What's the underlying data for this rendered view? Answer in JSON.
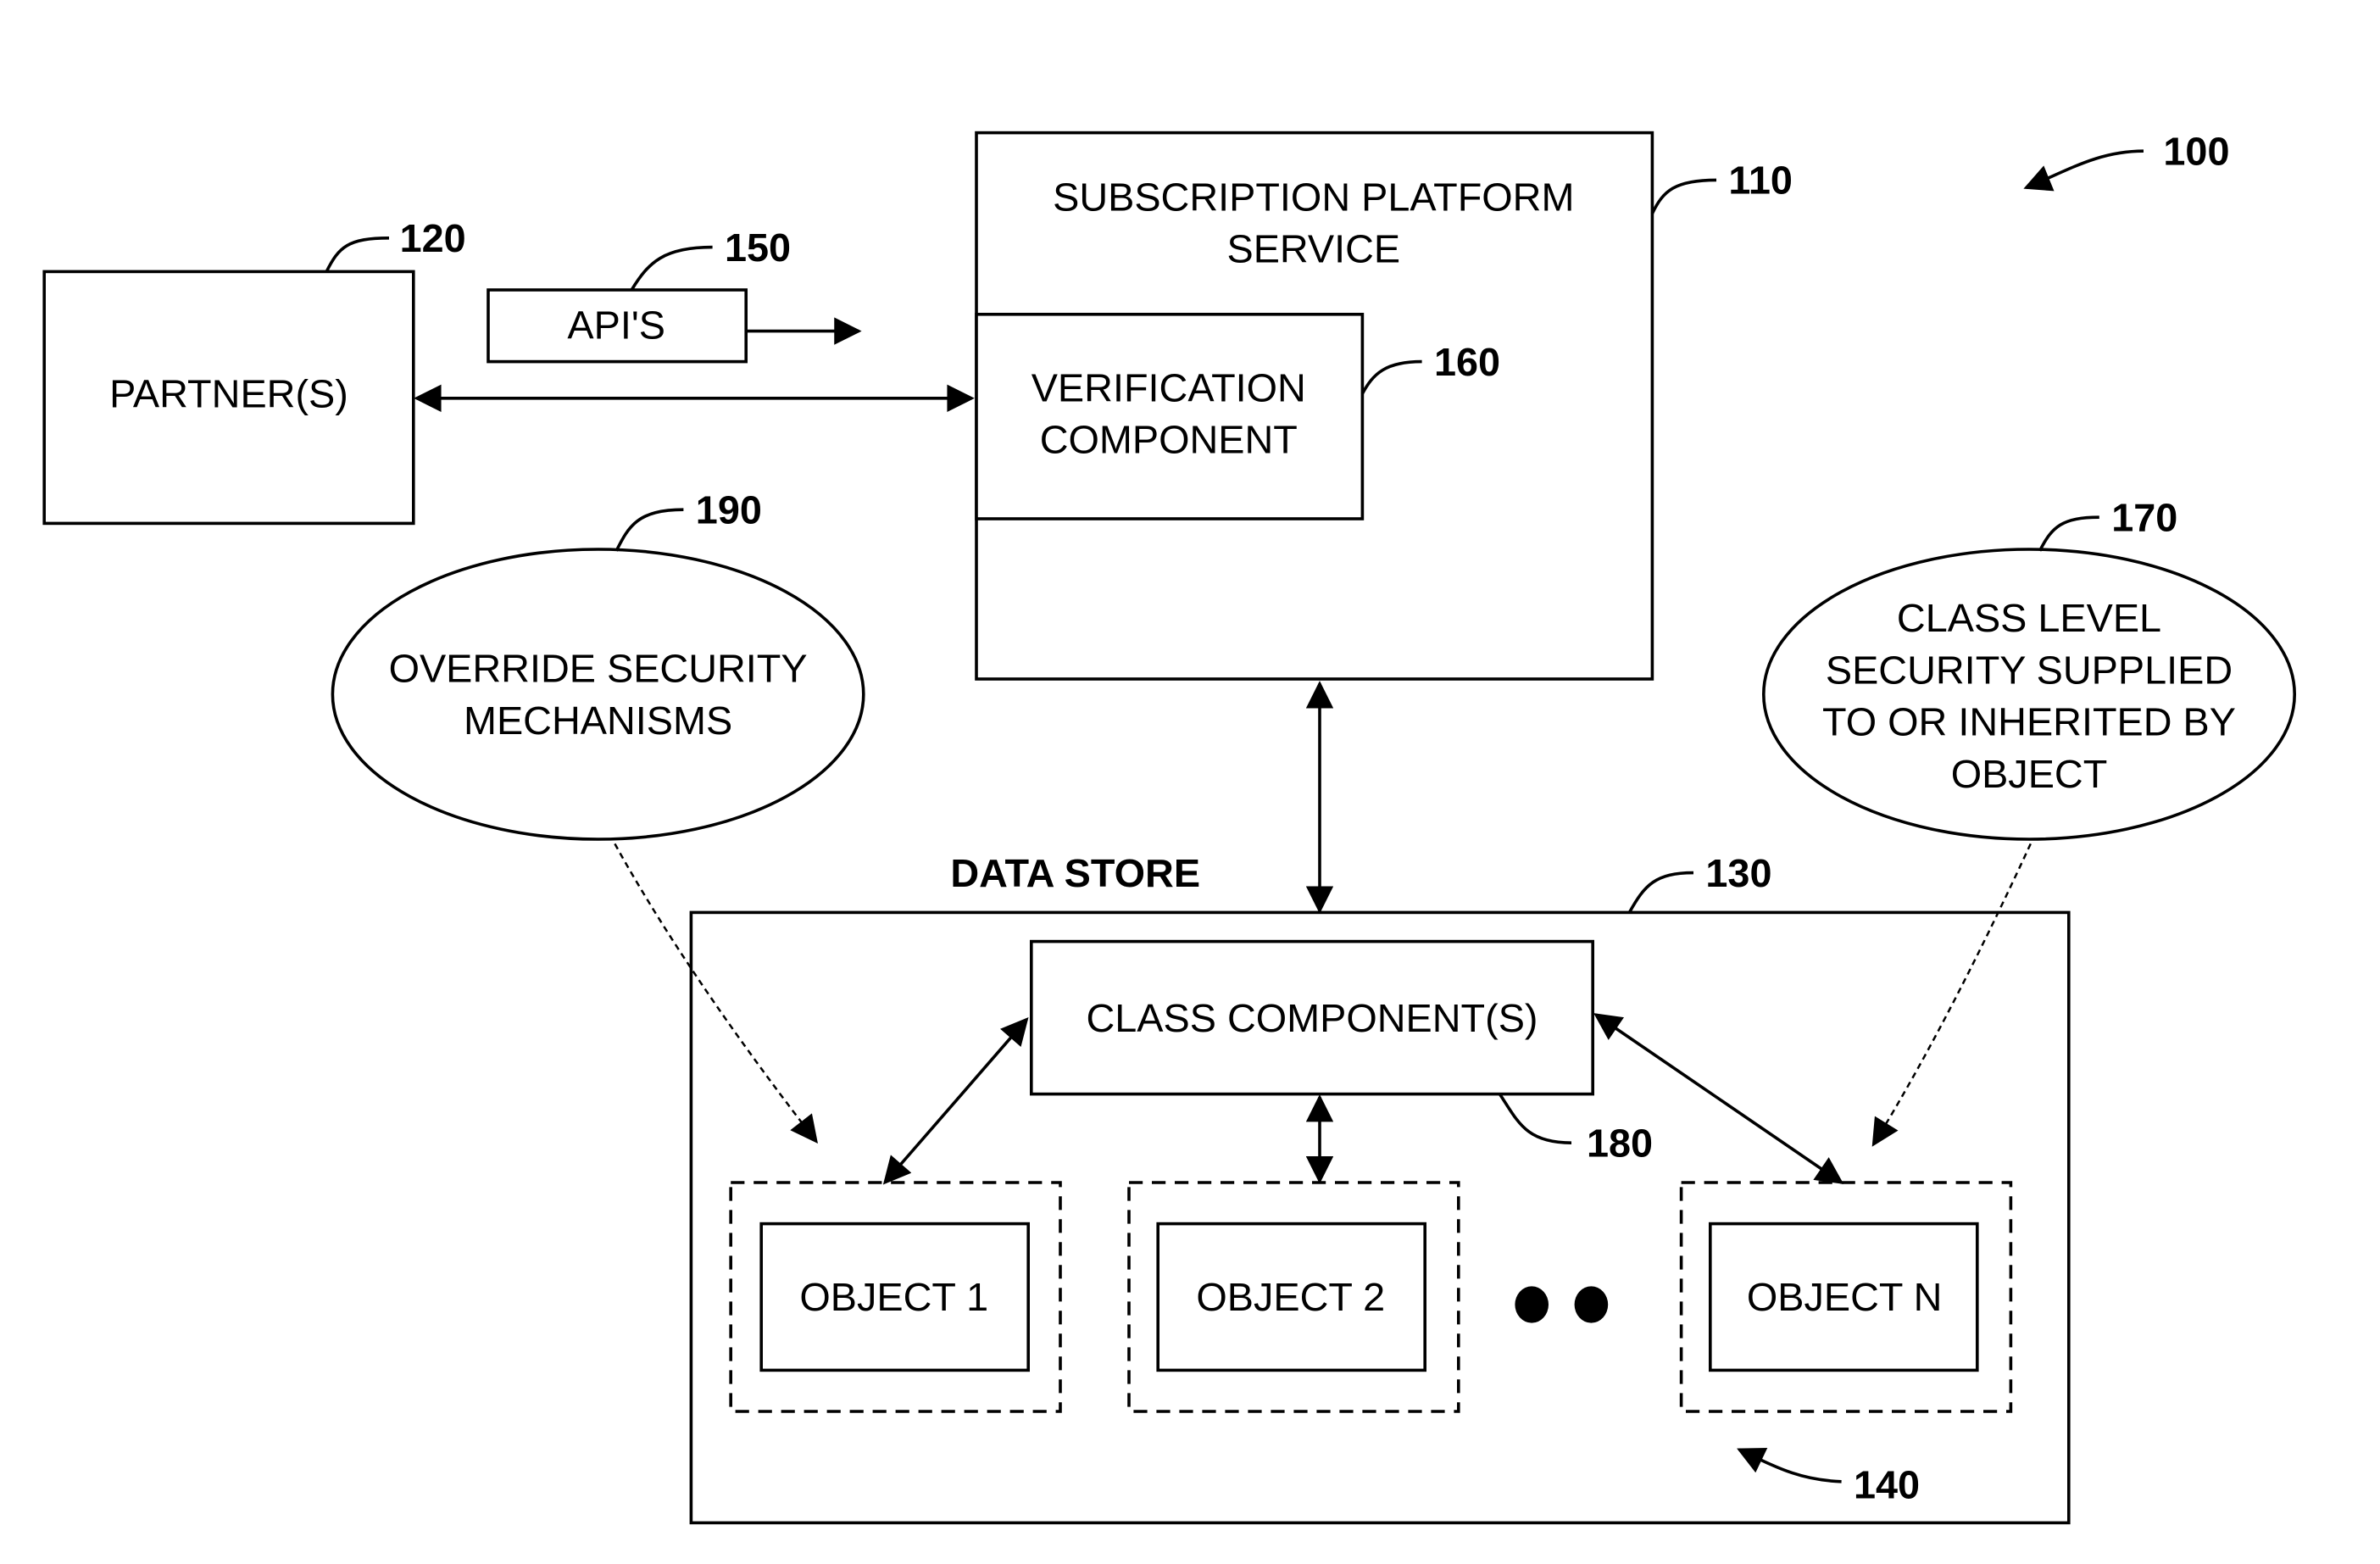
{
  "figure": {
    "ref": "100",
    "subscription_platform": {
      "line1": "SUBSCRIPTION PLATFORM",
      "line2": "SERVICE",
      "ref": "110"
    },
    "verification": {
      "line1": "VERIFICATION",
      "line2": "COMPONENT",
      "ref": "160"
    },
    "partners": {
      "label": "PARTNER(S)",
      "ref": "120"
    },
    "apis": {
      "label": "API'S",
      "ref": "150"
    },
    "override": {
      "line1": "OVERRIDE SECURITY",
      "line2": "MECHANISMS",
      "ref": "190"
    },
    "class_level": {
      "line1": "CLASS LEVEL",
      "line2": "SECURITY SUPPLIED",
      "line3": "TO OR INHERITED BY",
      "line4": "OBJECT",
      "ref": "170"
    },
    "data_store": {
      "title": "DATA STORE",
      "ref": "130"
    },
    "class_component": {
      "label": "CLASS COMPONENT(S)",
      "ref": "180"
    },
    "objects": [
      {
        "label": "OBJECT 1"
      },
      {
        "label": "OBJECT 2"
      },
      {
        "label": "OBJECT N"
      }
    ],
    "objects_ref": "140"
  }
}
